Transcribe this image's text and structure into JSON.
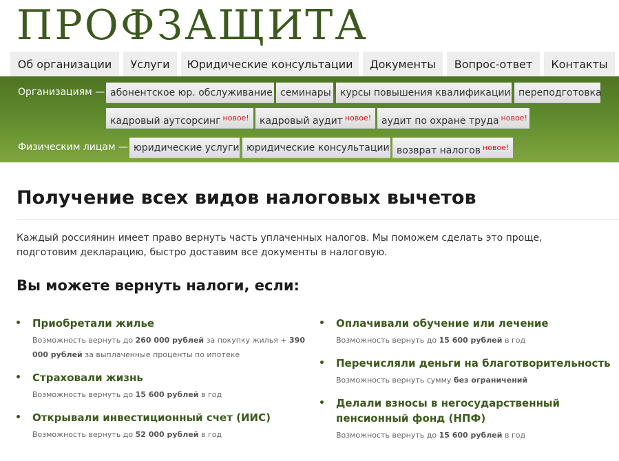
{
  "logo": "ПРОФЗАЩИТА",
  "nav": [
    {
      "label": "Об организации"
    },
    {
      "label": "Услуги"
    },
    {
      "label": "Юридические консультации"
    },
    {
      "label": "Документы"
    },
    {
      "label": "Вопрос-ответ"
    },
    {
      "label": "Контакты"
    }
  ],
  "subnav": {
    "org_label": "Организациям —",
    "org_items": [
      {
        "label": "абонентское юр. обслуживание",
        "badge": ""
      },
      {
        "label": "семинары",
        "badge": ""
      },
      {
        "label": "курсы повышения квалификации",
        "badge": ""
      },
      {
        "label": "переподготовка",
        "badge": ""
      },
      {
        "label": "кадровый аутсорсинг",
        "badge": "новое!"
      },
      {
        "label": "кадровый аудит",
        "badge": "новое!"
      },
      {
        "label": "аудит по охране труда",
        "badge": "новое!"
      }
    ],
    "ind_label": "Физическим лицам —",
    "ind_items": [
      {
        "label": "юридические услуги",
        "badge": ""
      },
      {
        "label": "юридические консультации",
        "badge": ""
      },
      {
        "label": "возврат налогов",
        "badge": "новое!"
      }
    ]
  },
  "content": {
    "title": "Получение всех видов налоговых вычетов",
    "intro": "Каждый россиянин имеет право вернуть часть уплаченных налогов. Мы поможем сделать это проще, подготовим декларацию, быстро доставим все документы в налоговую.",
    "subtitle": "Вы можете вернуть налоги, если:",
    "benefits": [
      {
        "title": "Приобретали жилье",
        "d1": "Возможность вернуть до ",
        "amount1": "260 000 рублей",
        "d2": " за покупку жилья + ",
        "amount2": "390 000 рублей",
        "d3": " за выплаченные проценты по ипотеке"
      },
      {
        "title": "Страховали жизнь",
        "d1": "Возможность вернуть до ",
        "amount1": "15 600 рублей",
        "d2": " в год"
      },
      {
        "title": "Открывали инвестиционный счет (ИИС)",
        "d1": "Возможность вернуть до ",
        "amount1": "52 000 рублей",
        "d2": " в год"
      },
      {
        "title": "Оплачивали обучение или лечение",
        "d1": "Возможность вернуть до ",
        "amount1": "15 600 рублей",
        "d2": " в год"
      },
      {
        "title": "Перечисляли деньги на благотворительность",
        "d1": "Возможность вернуть сумму ",
        "amount1": "без ограничений"
      },
      {
        "title": "Делали взносы в негосударственный пенсионный фонд (НПФ)",
        "d1": "Возможность вернуть до ",
        "amount1": "15 600 рублей",
        "d2": " в год"
      }
    ]
  },
  "colors": {
    "brand_green": "#3d5a1e",
    "bar_top": "#4f7424",
    "bar_bottom": "#7fa63f",
    "badge_red": "#d61a1a"
  }
}
